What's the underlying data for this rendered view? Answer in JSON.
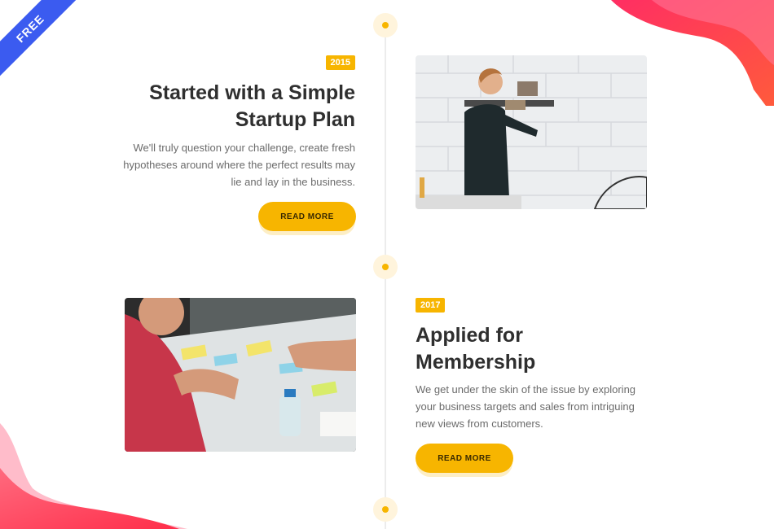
{
  "ribbon": {
    "label": "FREE"
  },
  "colors": {
    "accent": "#f7b500",
    "ribbon": "#3b5bf0",
    "blob": "#ff4a5c"
  },
  "timeline": [
    {
      "year": "2015",
      "title_line1": "Started with a Simple",
      "title_line2": "Startup Plan",
      "desc_line1": "We'll truly question your challenge, create fresh",
      "desc_line2": "hypotheses around where the perfect results may",
      "desc_line3": "lie and lay in the business.",
      "button_label": "READ MORE",
      "image": "man-at-wall-photo"
    },
    {
      "year": "2017",
      "title_line1": "Applied for",
      "title_line2": "Membership",
      "desc_line1": "We get under the skin of the issue by exploring",
      "desc_line2": "your business targets and sales from intriguing",
      "desc_line3": "new views from customers.",
      "button_label": "READ MORE",
      "image": "team-meeting-photo"
    }
  ]
}
